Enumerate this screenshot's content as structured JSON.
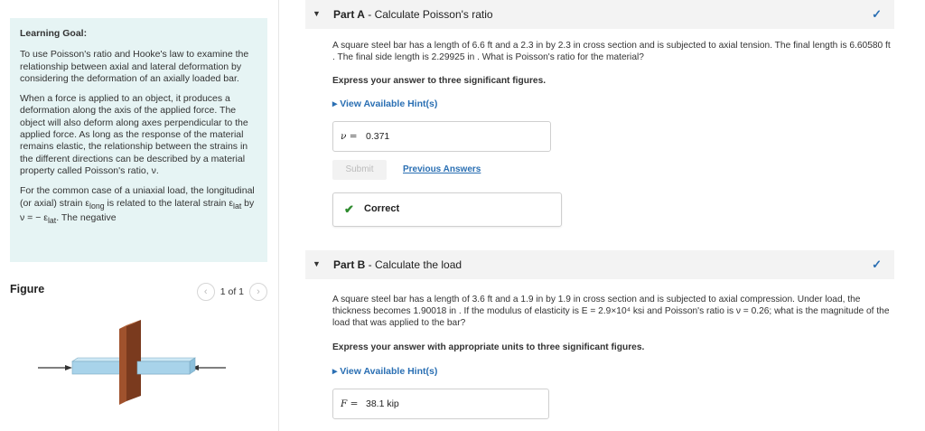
{
  "learning_goal": {
    "title": "Learning Goal:",
    "p1": "To use Poisson's ratio and Hooke's law to examine the relationship between axial and lateral deformation by considering the deformation of an axially loaded bar.",
    "p2": "When a force is applied to an object, it produces a deformation along the axis of the applied force. The object will also deform along axes perpendicular to the applied force. As long as the response of the material remains elastic, the relationship between the strains in the different directions can be described by a material property called Poisson's ratio, ν.",
    "p3_a": "For the common case of a uniaxial load, the longitudinal (or axial) strain ε",
    "p3_sub1": "long",
    "p3_b": " is related to the lateral strain ε",
    "p3_sub2": "lat",
    "p3_c": " by ν = − ε",
    "p3_frac_num": "lat",
    "p3_d": ". The negative"
  },
  "figure": {
    "title": "Figure",
    "pager": "1 of 1",
    "prev_icon": "chevron-left-icon",
    "next_icon": "chevron-right-icon"
  },
  "partA": {
    "label": "Part A",
    "title": " - Calculate Poisson's ratio",
    "question": "A square steel bar has a length of 6.6 ft and a 2.3 in by 2.3 in cross section and is subjected to axial tension. The final length is 6.60580 ft . The final side length is 2.29925 in . What is Poisson's ratio for the material?",
    "express": "Express your answer to three significant figures.",
    "hint": "▸ View Available Hint(s)",
    "answer_label": "ν =",
    "answer_value": "0.371",
    "submit": "Submit",
    "previous": "Previous Answers",
    "feedback": "Correct"
  },
  "partB": {
    "label": "Part B",
    "title": " - Calculate the load",
    "question": "A square steel bar has a length of 3.6 ft and a 1.9 in by 1.9 in cross section and is subjected to axial compression. Under load, the thickness becomes 1.90018 in . If the modulus of elasticity is E = 2.9×10⁴ ksi and Poisson's ratio is ν = 0.26; what is the magnitude of the load that was applied to the bar?",
    "express": "Express your answer with appropriate units to three significant figures.",
    "hint": "▸ View Available Hint(s)",
    "answer_label": "F =",
    "answer_value": "38.1 kip"
  },
  "colors": {
    "accent": "#2a6fb3",
    "goal_bg": "#e6f4f4",
    "correct": "#2e8b2e",
    "bar_blue": "#a8d3ea",
    "plate_brown": "#a0522d"
  }
}
